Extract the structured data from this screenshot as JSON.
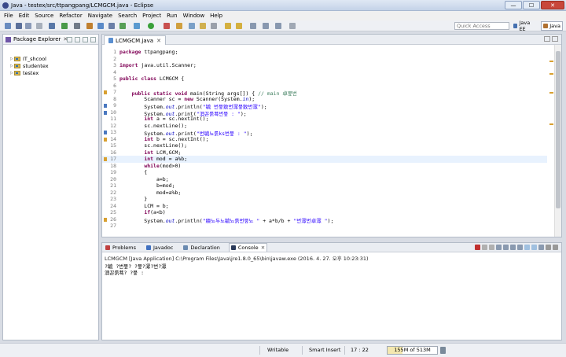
{
  "window": {
    "title": "Java - testex/src/ttpangpang/LCMGCM.java - Eclipse",
    "controls": [
      "—",
      "☐",
      "✕"
    ]
  },
  "menubar": [
    "File",
    "Edit",
    "Source",
    "Refactor",
    "Navigate",
    "Search",
    "Project",
    "Run",
    "Window",
    "Help"
  ],
  "toolbar": {
    "quick_access_placeholder": "Quick Access",
    "perspectives": [
      {
        "label": "Java EE",
        "active": false
      },
      {
        "label": "Java",
        "active": true
      }
    ]
  },
  "package_explorer": {
    "tab_label": "Package Explorer",
    "close": "✕",
    "projects": [
      "IT_shcool",
      "studentex",
      "testex"
    ]
  },
  "editor": {
    "tab_label": "LCMGCM.java",
    "close": "✕",
    "current_line": 17,
    "lines": [
      {
        "n": "1",
        "tokens": [
          {
            "t": "package ",
            "c": "kw"
          },
          {
            "t": "ttpangpang;",
            "c": ""
          }
        ]
      },
      {
        "n": "2",
        "tokens": []
      },
      {
        "n": "3",
        "tokens": [
          {
            "t": "import ",
            "c": "kw"
          },
          {
            "t": "java.util.Scanner;",
            "c": ""
          }
        ]
      },
      {
        "n": "4",
        "tokens": []
      },
      {
        "n": "5",
        "tokens": [
          {
            "t": "public class ",
            "c": "kw"
          },
          {
            "t": "LCMGCM {",
            "c": ""
          }
        ]
      },
      {
        "n": "6",
        "tokens": []
      },
      {
        "n": "7",
        "tokens": [
          {
            "t": "    public static void ",
            "c": "kw"
          },
          {
            "t": "main(String args[]) { ",
            "c": ""
          },
          {
            "t": "// main 卓뭎번",
            "c": "cm"
          }
        ]
      },
      {
        "n": "8",
        "tokens": [
          {
            "t": "        Scanner sc = ",
            "c": ""
          },
          {
            "t": "new ",
            "c": "kw"
          },
          {
            "t": "Scanner(System.",
            "c": ""
          },
          {
            "t": "in",
            "c": "fld"
          },
          {
            "t": ");",
            "c": ""
          }
        ]
      },
      {
        "n": "9",
        "tokens": [
          {
            "t": "        System.",
            "c": ""
          },
          {
            "t": "out",
            "c": "fld"
          },
          {
            "t": ".println(",
            "c": ""
          },
          {
            "t": "\"毓 번뭎敫번潀뭎敫번潀\"",
            "c": "str"
          },
          {
            "t": ");",
            "c": ""
          }
        ]
      },
      {
        "n": "10",
        "tokens": [
          {
            "t": "        System.",
            "c": ""
          },
          {
            "t": "out",
            "c": "fld"
          },
          {
            "t": ".print(",
            "c": ""
          },
          {
            "t": "\"浿꼰룱쬭번뭎 : \"",
            "c": "str"
          },
          {
            "t": ");",
            "c": ""
          }
        ]
      },
      {
        "n": "11",
        "tokens": [
          {
            "t": "        ",
            "c": ""
          },
          {
            "t": "int ",
            "c": "kw"
          },
          {
            "t": "a = sc.nextInt();",
            "c": ""
          }
        ]
      },
      {
        "n": "12",
        "tokens": [
          {
            "t": "        sc.nextLine();",
            "c": ""
          }
        ]
      },
      {
        "n": "13",
        "tokens": [
          {
            "t": "        System.",
            "c": ""
          },
          {
            "t": "out",
            "c": "fld"
          },
          {
            "t": ".print(",
            "c": ""
          },
          {
            "t": "\"번毓뇨룱ks번뭎 : \"",
            "c": "str"
          },
          {
            "t": ");",
            "c": ""
          }
        ]
      },
      {
        "n": "14",
        "tokens": [
          {
            "t": "        ",
            "c": ""
          },
          {
            "t": "int ",
            "c": "kw"
          },
          {
            "t": "b = sc.nextInt();",
            "c": ""
          }
        ]
      },
      {
        "n": "15",
        "tokens": [
          {
            "t": "        sc.nextLine();",
            "c": ""
          }
        ]
      },
      {
        "n": "16",
        "tokens": [
          {
            "t": "        ",
            "c": ""
          },
          {
            "t": "int ",
            "c": "kw"
          },
          {
            "t": "LCM,GCM;",
            "c": ""
          }
        ]
      },
      {
        "n": "17",
        "tokens": [
          {
            "t": "        ",
            "c": ""
          },
          {
            "t": "int ",
            "c": "kw"
          },
          {
            "t": "mod = a%b;",
            "c": ""
          }
        ]
      },
      {
        "n": "18",
        "tokens": [
          {
            "t": "        ",
            "c": ""
          },
          {
            "t": "while",
            "c": "kw"
          },
          {
            "t": "(mod>0)",
            "c": ""
          }
        ]
      },
      {
        "n": "19",
        "tokens": [
          {
            "t": "        {",
            "c": ""
          }
        ]
      },
      {
        "n": "20",
        "tokens": [
          {
            "t": "            a=b;",
            "c": ""
          }
        ]
      },
      {
        "n": "21",
        "tokens": [
          {
            "t": "            b=mod;",
            "c": ""
          }
        ]
      },
      {
        "n": "22",
        "tokens": [
          {
            "t": "            mod=a%b;",
            "c": ""
          }
        ]
      },
      {
        "n": "23",
        "tokens": [
          {
            "t": "        }",
            "c": ""
          }
        ]
      },
      {
        "n": "24",
        "tokens": [
          {
            "t": "        LCM = b;",
            "c": ""
          }
        ]
      },
      {
        "n": "25",
        "tokens": [
          {
            "t": "        ",
            "c": ""
          },
          {
            "t": "if",
            "c": "kw"
          },
          {
            "t": "(a<b)",
            "c": ""
          }
        ]
      },
      {
        "n": "26",
        "tokens": [
          {
            "t": "        System.",
            "c": ""
          },
          {
            "t": "out",
            "c": "fld"
          },
          {
            "t": ".println(",
            "c": ""
          },
          {
            "t": "\"緛뇨두뇨毓뇨룱번뭎뇨 \"",
            "c": "str"
          },
          {
            "t": " + a*b/b + ",
            "c": ""
          },
          {
            "t": "\"번潀번卓潀 \"",
            "c": "str"
          },
          {
            "t": ");",
            "c": ""
          }
        ]
      },
      {
        "n": "27",
        "tokens": []
      }
    ]
  },
  "bottom_panel": {
    "tabs": [
      {
        "label": "Problems",
        "active": false
      },
      {
        "label": "Javadoc",
        "active": false
      },
      {
        "label": "Declaration",
        "active": false
      },
      {
        "label": "Console",
        "active": true
      }
    ],
    "console_label": "LCMGCM [Java Application] C:\\Program Files\\Java\\jre1.8.0_65\\bin\\javaw.exe (2016. 4. 27. 오후 10:23:31)",
    "output": [
      "?毓 ?번뭎? ?뭎?潀?번?潀",
      "浿꼰룱쬭? ?뭎 :"
    ]
  },
  "statusbar": {
    "mode": "Writable",
    "insert": "Smart Insert",
    "position": "17 : 22",
    "heap": "155M of 513M",
    "heap_used_fraction": 0.3
  }
}
